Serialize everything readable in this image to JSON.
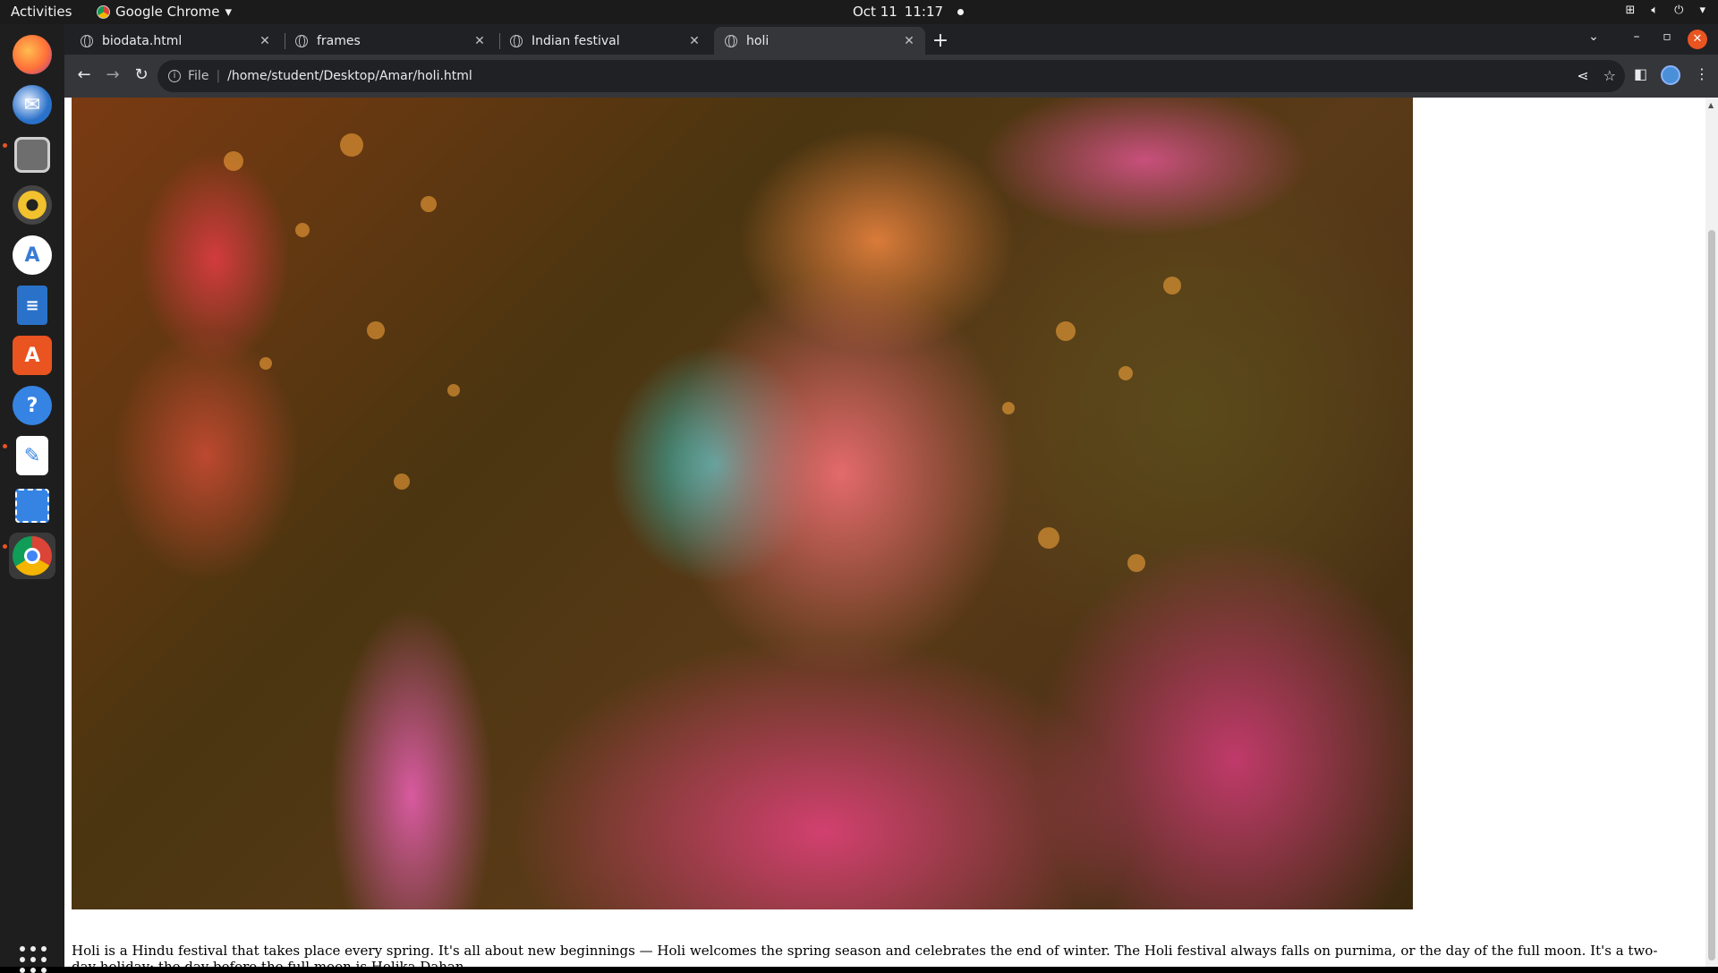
{
  "topbar": {
    "activities": "Activities",
    "app_name": "Google Chrome",
    "date": "Oct 11",
    "time": "11:17"
  },
  "dock": {
    "items": [
      {
        "name": "firefox-icon",
        "color": "#ff7139"
      },
      {
        "name": "thunderbird-icon",
        "color": "#2a71c9"
      },
      {
        "name": "files-icon",
        "color": "#8a8a8a"
      },
      {
        "name": "rhythmbox-icon",
        "color": "#f2c12e"
      },
      {
        "name": "android-studio-icon",
        "color": "#4a90d9"
      },
      {
        "name": "libreoffice-writer-icon",
        "color": "#2a72c9"
      },
      {
        "name": "ubuntu-software-icon",
        "color": "#e95420"
      },
      {
        "name": "help-icon",
        "color": "#3584e4"
      },
      {
        "name": "text-editor-icon",
        "color": "#ffffff"
      },
      {
        "name": "screenshot-icon",
        "color": "#3584e4"
      },
      {
        "name": "chrome-icon",
        "color": "#db4437"
      }
    ]
  },
  "browser": {
    "tabs": [
      {
        "label": "biodata.html"
      },
      {
        "label": "frames"
      },
      {
        "label": "Indian festival"
      },
      {
        "label": "holi"
      }
    ],
    "address": {
      "scheme": "File",
      "url": "/home/student/Desktop/Amar/holi.html"
    }
  },
  "page": {
    "caption": "Holi is a Hindu festival that takes place every spring. It's all about new beginnings — Holi welcomes the spring season and celebrates the end of winter. The Holi festival always falls on purnima, or the day of the full moon. It's a two-day holiday; the day before the full moon is Holika Dahan"
  },
  "colors": {
    "tabstrip": "#202124",
    "toolbar": "#35363a",
    "accent": "#e95420"
  }
}
